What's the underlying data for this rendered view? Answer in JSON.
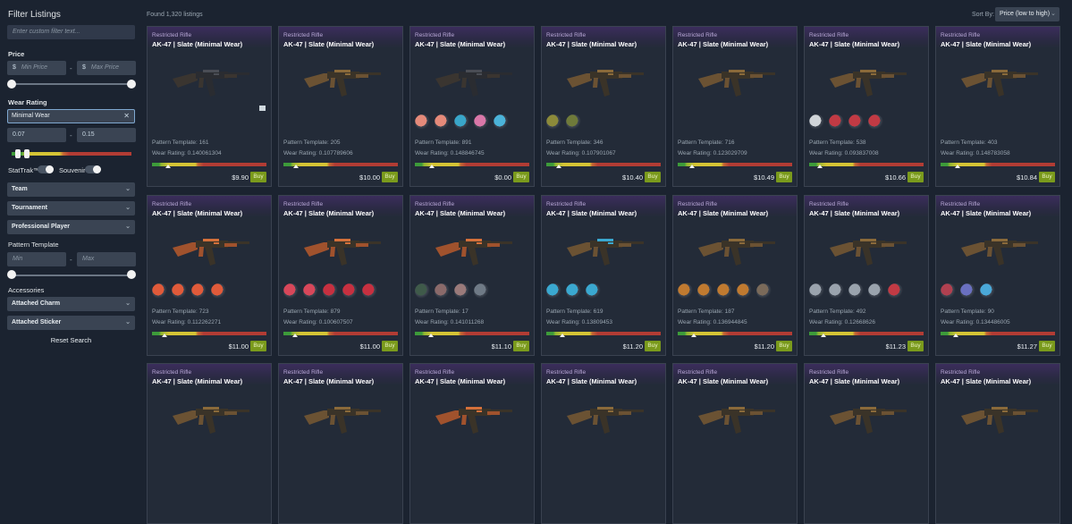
{
  "sidebar": {
    "title": "Filter Listings",
    "custom_filter_placeholder": "Enter custom filter text...",
    "price_label": "Price",
    "price_min_placeholder": "Min Price",
    "price_max_placeholder": "Max Price",
    "currency_symbol": "$",
    "wear_label": "Wear Rating",
    "wear_selected": "Minimal Wear",
    "wear_min": "0.07",
    "wear_max": "0.15",
    "stattrak_label": "StatTrak™",
    "souvenir_label": "Souvenir",
    "dropdowns": [
      "Team",
      "Tournament",
      "Professional Player"
    ],
    "pattern_label": "Pattern Template",
    "pattern_min_placeholder": "Min",
    "pattern_max_placeholder": "Max",
    "accessories_label": "Accessories",
    "accessory_dropdowns": [
      "Attached Charm",
      "Attached Sticker"
    ],
    "reset_label": "Reset Search",
    "dash": "-",
    "close_glyph": "✕",
    "chevron_glyph": "⌄"
  },
  "header": {
    "found_text": "Found 1,320 listings",
    "sort_label": "Sort By:",
    "sort_value": "Price (low to high)"
  },
  "colors": {
    "accent": "#7a9a1c",
    "rarity": "#b9a8d8",
    "background": "#1b2330"
  },
  "listings": [
    {
      "rarity": "Restricted Rifle",
      "name": "AK-47 | Slate (Minimal Wear)",
      "pattern": "Pattern Template: 161",
      "wear": "Wear Rating: 0.140061304",
      "wear_value": 0.140061304,
      "price": "$9.90",
      "buy": "Buy",
      "stickers": [],
      "gun_style": "dark",
      "trade_icon": true
    },
    {
      "rarity": "Restricted Rifle",
      "name": "AK-47 | Slate (Minimal Wear)",
      "pattern": "Pattern Template: 205",
      "wear": "Wear Rating: 0.107789606",
      "wear_value": 0.107789606,
      "price": "$10.00",
      "buy": "Buy",
      "stickers": [],
      "gun_style": "normal"
    },
    {
      "rarity": "Restricted Rifle",
      "name": "AK-47 | Slate (Minimal Wear)",
      "pattern": "Pattern Template: 891",
      "wear": "Wear Rating: 0.148846745",
      "wear_value": 0.148846745,
      "price": "$0.00",
      "buy": "Buy",
      "stickers": [
        "#e58a7a",
        "#e58a7a",
        "#39a6c9",
        "#d977a8",
        "#4bb3d9"
      ],
      "gun_style": "dark"
    },
    {
      "rarity": "Restricted Rifle",
      "name": "AK-47 | Slate (Minimal Wear)",
      "pattern": "Pattern Template: 346",
      "wear": "Wear Rating: 0.107901067",
      "wear_value": 0.107901067,
      "price": "$10.40",
      "buy": "Buy",
      "stickers": [
        "#8c8a3a",
        "#6f7a3a"
      ],
      "gun_style": "normal"
    },
    {
      "rarity": "Restricted Rifle",
      "name": "AK-47 | Slate (Minimal Wear)",
      "pattern": "Pattern Template: 716",
      "wear": "Wear Rating: 0.123029709",
      "wear_value": 0.123029709,
      "price": "$10.49",
      "buy": "Buy",
      "stickers": [],
      "gun_style": "normal"
    },
    {
      "rarity": "Restricted Rifle",
      "name": "AK-47 | Slate (Minimal Wear)",
      "pattern": "Pattern Template: 538",
      "wear": "Wear Rating: 0.093837008",
      "wear_value": 0.093837008,
      "price": "$10.66",
      "buy": "Buy",
      "stickers": [
        "#d0d4d8",
        "#c23a44",
        "#c23a44",
        "#c23a44"
      ],
      "gun_style": "normal"
    },
    {
      "rarity": "Restricted Rifle",
      "name": "AK-47 | Slate (Minimal Wear)",
      "pattern": "Pattern Template: 403",
      "wear": "Wear Rating: 0.148783058",
      "wear_value": 0.148783058,
      "price": "$10.84",
      "buy": "Buy",
      "stickers": [],
      "gun_style": "normal"
    },
    {
      "rarity": "Restricted Rifle",
      "name": "AK-47 | Slate (Minimal Wear)",
      "pattern": "Pattern Template: 723",
      "wear": "Wear Rating: 0.112262271",
      "wear_value": 0.112262271,
      "price": "$11.00",
      "buy": "Buy",
      "stickers": [
        "#e05a3a",
        "#e05a3a",
        "#e05a3a",
        "#e05a3a"
      ],
      "gun_style": "orange"
    },
    {
      "rarity": "Restricted Rifle",
      "name": "AK-47 | Slate (Minimal Wear)",
      "pattern": "Pattern Template: 879",
      "wear": "Wear Rating: 0.100607507",
      "wear_value": 0.100607507,
      "price": "$11.00",
      "buy": "Buy",
      "stickers": [
        "#d8475a",
        "#d8475a",
        "#c73040",
        "#c73040",
        "#c73040"
      ],
      "gun_style": "orange"
    },
    {
      "rarity": "Restricted Rifle",
      "name": "AK-47 | Slate (Minimal Wear)",
      "pattern": "Pattern Template: 17",
      "wear": "Wear Rating: 0.141011268",
      "wear_value": 0.141011268,
      "price": "$11.10",
      "buy": "Buy",
      "stickers": [
        "#3f5a4a",
        "#8a6a6a",
        "#9a7a7a",
        "#6f7a86"
      ],
      "gun_style": "orange"
    },
    {
      "rarity": "Restricted Rifle",
      "name": "AK-47 | Slate (Minimal Wear)",
      "pattern": "Pattern Template: 619",
      "wear": "Wear Rating: 0.13809453",
      "wear_value": 0.13809453,
      "price": "$11.20",
      "buy": "Buy",
      "stickers": [
        "#3aa8d0",
        "#3aa8d0",
        "#3aa8d0"
      ],
      "gun_style": "cyan"
    },
    {
      "rarity": "Restricted Rifle",
      "name": "AK-47 | Slate (Minimal Wear)",
      "pattern": "Pattern Template: 187",
      "wear": "Wear Rating: 0.136944845",
      "wear_value": 0.136944845,
      "price": "$11.20",
      "buy": "Buy",
      "stickers": [
        "#c07a30",
        "#c07a30",
        "#c07a30",
        "#c07a30",
        "#7a6a5a"
      ],
      "gun_style": "normal"
    },
    {
      "rarity": "Restricted Rifle",
      "name": "AK-47 | Slate (Minimal Wear)",
      "pattern": "Pattern Template: 492",
      "wear": "Wear Rating: 0.12668626",
      "wear_value": 0.12668626,
      "price": "$11.23",
      "buy": "Buy",
      "stickers": [
        "#9aa3ad",
        "#9aa3ad",
        "#9aa3ad",
        "#9aa3ad",
        "#c23a44"
      ],
      "gun_style": "normal"
    },
    {
      "rarity": "Restricted Rifle",
      "name": "AK-47 | Slate (Minimal Wear)",
      "pattern": "Pattern Template: 90",
      "wear": "Wear Rating: 0.134486005",
      "wear_value": 0.134486005,
      "price": "$11.27",
      "buy": "Buy",
      "stickers": [
        "#b04050",
        "#6a70c0",
        "#4aa8d8"
      ],
      "gun_style": "normal"
    },
    {
      "rarity": "Restricted Rifle",
      "name": "AK-47 | Slate (Minimal Wear)",
      "gun_style": "normal"
    },
    {
      "rarity": "Restricted Rifle",
      "name": "AK-47 | Slate (Minimal Wear)",
      "gun_style": "normal"
    },
    {
      "rarity": "Restricted Rifle",
      "name": "AK-47 | Slate (Minimal Wear)",
      "gun_style": "orange"
    },
    {
      "rarity": "Restricted Rifle",
      "name": "AK-47 | Slate (Minimal Wear)",
      "gun_style": "normal"
    },
    {
      "rarity": "Restricted Rifle",
      "name": "AK-47 | Slate (Minimal Wear)",
      "gun_style": "normal"
    },
    {
      "rarity": "Restricted Rifle",
      "name": "AK-47 | Slate (Minimal Wear)",
      "gun_style": "normal"
    },
    {
      "rarity": "Restricted Rifle",
      "name": "AK-47 | Slate (Minimal Wear)",
      "gun_style": "normal"
    }
  ]
}
